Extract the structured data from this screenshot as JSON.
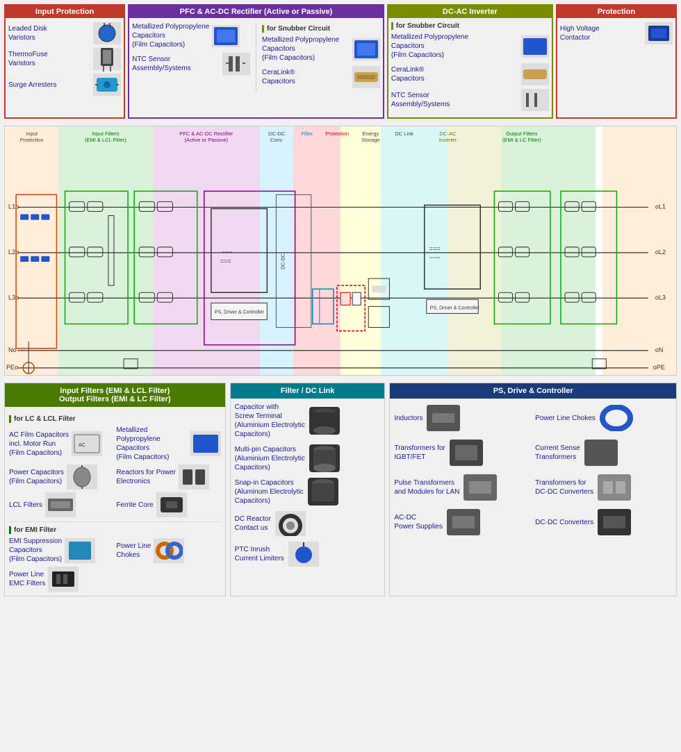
{
  "topBoxes": {
    "inputProtection": {
      "header": "Input Protection",
      "items": [
        {
          "text": "Leaded Disk Varistors",
          "img": "varistor"
        },
        {
          "text": "ThermoFuse Varistors",
          "img": "thermofuse"
        },
        {
          "text": "Surge Arresters",
          "img": "surge"
        }
      ]
    },
    "pfc": {
      "header": "PFC & AC-DC Rectifier (Active or Passive)",
      "items": [
        {
          "text": "Metallized Polypropylene Capacitors (Film Capacitors)",
          "img": "film-cap"
        },
        {
          "text": "NTC Sensor Assembly/Systems",
          "img": "ntc"
        }
      ],
      "snubberLabel": "for Snubber Circuit",
      "snubberItems": [
        {
          "text": "Metallized Polypropylene Capacitors (Film Capacitors)",
          "img": "film-cap"
        },
        {
          "text": "CeraLink® Capacitors",
          "img": "cera"
        }
      ]
    },
    "dcAc": {
      "header": "DC-AC Inverter",
      "snubberLabel": "for Snubber Circuit",
      "items": [
        {
          "text": "Metallized Polypropylene Capacitors (Film Capacitors)",
          "img": "film-cap"
        },
        {
          "text": "CeraLink® Capacitors",
          "img": "cera"
        },
        {
          "text": "NTC Sensor Assembly/Systems",
          "img": "ntc"
        }
      ]
    },
    "protection": {
      "header": "Protection",
      "items": [
        {
          "text": "High Voltage Contactor",
          "img": "contactor"
        }
      ]
    }
  },
  "circuitLabels": [
    {
      "text": "Input Protection",
      "left": "2%"
    },
    {
      "text": "Input Filters\n(EMI & LCL Filter)",
      "left": "12%"
    },
    {
      "text": "PFC & AC-DC Rectifier\n(Active or Passive)",
      "left": "27%"
    },
    {
      "text": "DC-DC\nConverter",
      "left": "40%"
    },
    {
      "text": "Filter",
      "left": "44.5%"
    },
    {
      "text": "Protection",
      "left": "48.5%"
    },
    {
      "text": "Energy\nStorage",
      "left": "53%"
    },
    {
      "text": "DC Link",
      "left": "57%"
    },
    {
      "text": "DC-AC\nInverter",
      "left": "64%"
    },
    {
      "text": "Output Filters\n(EMI & LC Filter)",
      "left": "82%"
    }
  ],
  "bottomBoxes": {
    "inputFilters": {
      "header": "Input Filters (EMI & LCL Filter)\nOutput Filters (EMI & LC Filter)",
      "lcLabel": "for LC & LCL Filter",
      "lcItems": [
        {
          "text": "AC Film Capacitors incl. Motor Run (Film Capacitors)",
          "img": "ac-film"
        },
        {
          "text": "Metallized Polypropylene Capacitors (Film Capacitors)",
          "img": "film-cap-blue"
        },
        {
          "text": "Power Capacitors (Film Capacitors)",
          "img": "power-cap"
        },
        {
          "text": "Reactors for Power Electronics",
          "img": "reactors"
        },
        {
          "text": "LCL Filters",
          "img": "lcl"
        },
        {
          "text": "Ferrite Core",
          "img": "ferrite"
        }
      ],
      "emiLabel": "for EMI Filter",
      "emiItems": [
        {
          "text": "EMI Suppression Capacitors (Film Capacitors)",
          "img": "emi-cap"
        },
        {
          "text": "Power Line Chokes",
          "img": "chokes"
        },
        {
          "text": "Power Line EMC Filters",
          "img": "emc"
        }
      ]
    },
    "filterDcLink": {
      "header": "Filter / DC Link",
      "items": [
        {
          "text": "Capacitor with Screw Terminal (Aluminium Electrolytic Capacitors)",
          "img": "screw-cap"
        },
        {
          "text": "Multi-pin Capacitors (Aluminium Electrolytic Capacitors)",
          "img": "multi-cap"
        },
        {
          "text": "Snap-in Capacitors (Aluminum Electrolytic Capacitors)",
          "img": "snap-cap"
        },
        {
          "text": "DC Reactor Contact us",
          "img": "dc-reactor"
        },
        {
          "text": "PTC Inrush Current Limiters",
          "img": "ptc"
        }
      ]
    },
    "psDrive": {
      "header": "PS, Drive & Controller",
      "items": [
        {
          "text": "Inductors",
          "img": "inductors"
        },
        {
          "text": "Power Line Chokes",
          "img": "pl-chokes"
        },
        {
          "text": "Transformers for IGBT/FET",
          "img": "igbt-trans"
        },
        {
          "text": "Current Sense Transformers",
          "img": "cs-trans"
        },
        {
          "text": "Pulse Transformers and Modules for LAN",
          "img": "pulse-trans"
        },
        {
          "text": "Transformers for DC-DC Converters",
          "img": "dc-trans"
        },
        {
          "text": "AC-DC Power Supplies",
          "img": "acdc-ps"
        },
        {
          "text": "DC-DC Converters",
          "img": "dcdc-conv"
        }
      ]
    }
  }
}
